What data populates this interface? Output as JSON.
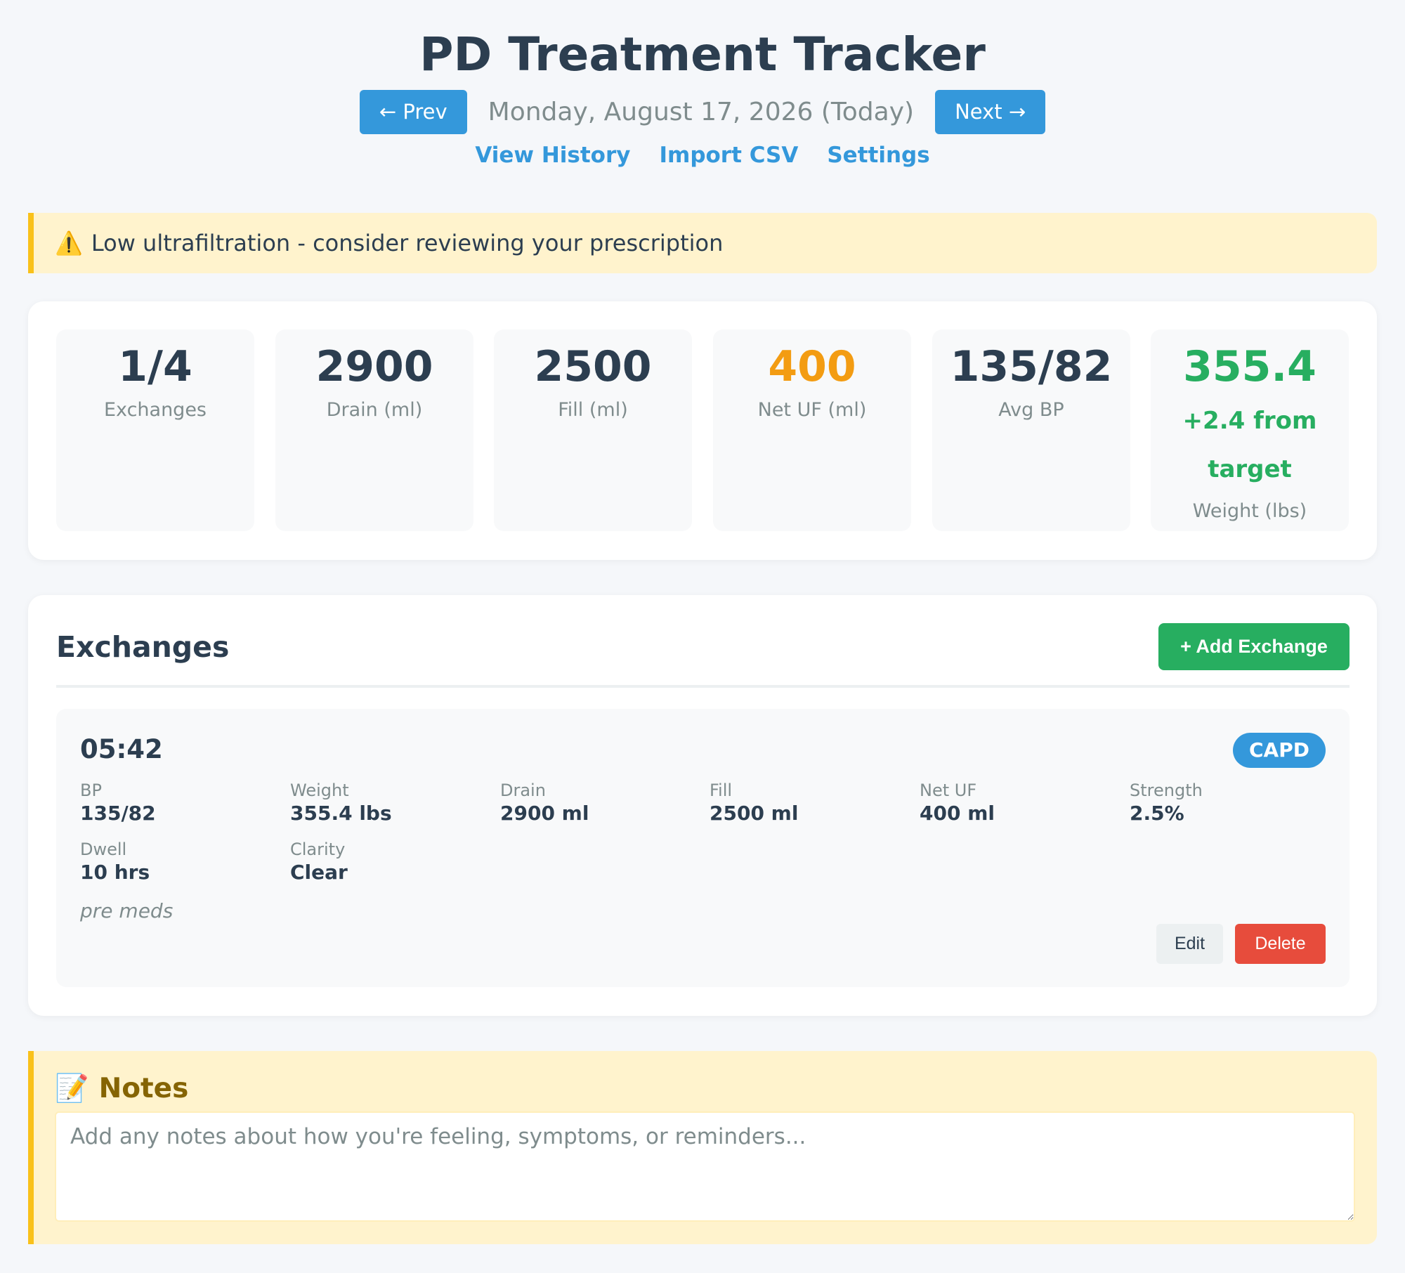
{
  "header": {
    "title": "PD Treatment Tracker",
    "prev_label": "← Prev",
    "date": "Monday, August 17, 2026 (Today)",
    "next_label": "Next →",
    "links": [
      "View History",
      "Import CSV",
      "Settings"
    ]
  },
  "alert": {
    "icon": "⚠️",
    "text": "Low ultrafiltration - consider reviewing your prescription"
  },
  "summary": [
    {
      "value": "1/4",
      "label": "Exchanges"
    },
    {
      "value": "2900",
      "label": "Drain (ml)"
    },
    {
      "value": "2500",
      "label": "Fill (ml)"
    },
    {
      "value": "400",
      "label": "Net UF (ml)",
      "color": "#f39c12"
    },
    {
      "value": "135/82",
      "label": "Avg BP"
    },
    {
      "value": "355.4",
      "sub": "+2.4 from target",
      "label": "Weight (lbs)",
      "color": "#27ae60"
    }
  ],
  "exchanges": {
    "title": "Exchanges",
    "add_label": "+ Add Exchange",
    "items": [
      {
        "time": "05:42",
        "type": "CAPD",
        "fields": [
          {
            "label": "BP",
            "value": "135/82"
          },
          {
            "label": "Weight",
            "value": "355.4 lbs"
          },
          {
            "label": "Drain",
            "value": "2900 ml"
          },
          {
            "label": "Fill",
            "value": "2500 ml"
          },
          {
            "label": "Net UF",
            "value": "400 ml"
          },
          {
            "label": "Strength",
            "value": "2.5%"
          },
          {
            "label": "Dwell",
            "value": "10 hrs"
          },
          {
            "label": "Clarity",
            "value": "Clear"
          }
        ],
        "note": "pre meds",
        "edit_label": "Edit",
        "delete_label": "Delete"
      }
    ]
  },
  "notes": {
    "icon": "📝",
    "title": "Notes",
    "value": "",
    "placeholder": "Add any notes about how you're feeling, symptoms, or reminders..."
  },
  "colors": {
    "primary": "#3498db",
    "success": "#27ae60",
    "warning": "#f39c12",
    "danger": "#e74c3c",
    "alert_bg": "#fff3cd",
    "alert_border": "#f9c11a"
  }
}
